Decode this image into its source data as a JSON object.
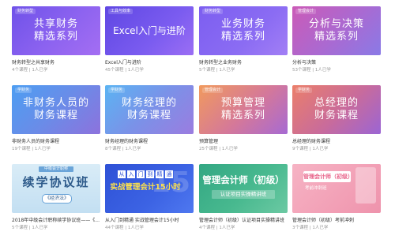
{
  "cards": [
    {
      "tag": "财务转型",
      "line1": "共享财务",
      "line2": "精选系列",
      "name": "财务转型之共享财务",
      "count": "4个课程",
      "learners": "1人已学"
    },
    {
      "tag": "工具与效率",
      "line1": "Excel入门与进阶",
      "line2": "",
      "name": "Excel入门与进阶",
      "count": "45个课程",
      "learners": "1人已学"
    },
    {
      "tag": "财务转型",
      "line1": "业务财务",
      "line2": "精选系列",
      "name": "财务转型之业务财务",
      "count": "5个课程",
      "learners": "1人已学"
    },
    {
      "tag": "管理会计",
      "line1": "分析与决策",
      "line2": "精选系列",
      "name": "分析与决策",
      "count": "53个课程",
      "learners": "1人已学"
    },
    {
      "tag": "学财务",
      "line1": "非财务人员的",
      "line2": "财务课程",
      "name": "非财务人员的财务课程",
      "count": "19个课程",
      "learners": "1人已学"
    },
    {
      "tag": "学财务",
      "line1": "财务经理的",
      "line2": "财务课程",
      "name": "财务经理的财务课程",
      "count": "8个课程",
      "learners": "1人已学"
    },
    {
      "tag": "管理会计",
      "line1": "预算管理",
      "line2": "精选系列",
      "name": "预算管理",
      "count": "25个课程",
      "learners": "1人已学"
    },
    {
      "tag": "学财务",
      "line1": "总经理的",
      "line2": "财务课程",
      "name": "总经理的财务课程",
      "count": "9个课程",
      "learners": "1人已学"
    },
    {
      "ribbon": "中级会计职称",
      "title": "续学协议班",
      "sub": "《经济法》",
      "name": "2018年中级会计职称续学协议班——《...",
      "count": "5个课程",
      "learners": "1人已学"
    },
    {
      "chars": [
        "从",
        "入",
        "门",
        "到",
        "精",
        "通"
      ],
      "title": "实战管理会计15小时",
      "bignum": "15",
      "name": "从入门到精通 实战管理会计15小时",
      "count": "44个课程",
      "learners": "1人已学"
    },
    {
      "title": "管理会计师（初级）",
      "sub": "认证项目实操精讲班",
      "name": "管理会计师（初级）认证项目实操精讲班",
      "count": "4个课程",
      "learners": "1人已学"
    },
    {
      "title": "管理会计师（初级）",
      "sub": "考前冲刺班",
      "name": "管理会计师（初级）考前冲刺",
      "count": "3个课程",
      "learners": "1人已学"
    }
  ]
}
